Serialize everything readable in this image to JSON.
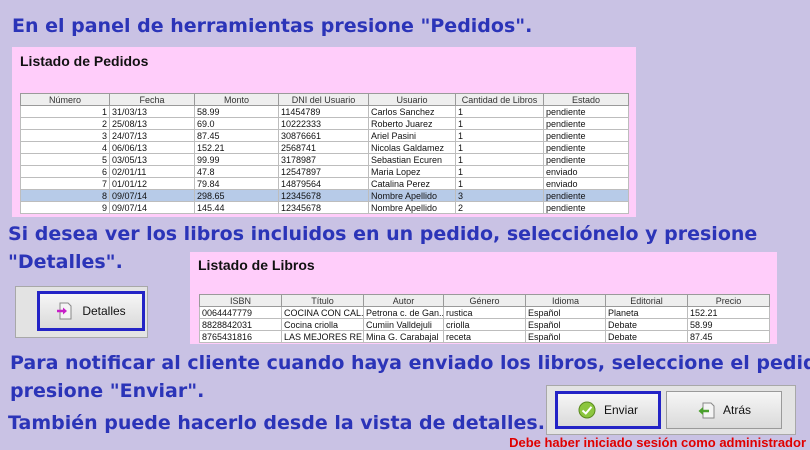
{
  "instructions": {
    "step1": "En el panel de herramientas presione \"Pedidos\".",
    "step2_line1": "Si desea ver los libros incluidos en un pedido, selecciónelo y presione",
    "step2_line2": "\"Detalles\".",
    "step3_line1": "Para notificar al cliente cuando haya enviado los libros, seleccione el pedido y",
    "step3_line2": "presione \"Enviar\".",
    "step4": "También puede hacerlo desde la vista de detalles.",
    "note": "Debe haber iniciado sesión como administrador"
  },
  "orders_panel": {
    "title": "Listado de Pedidos",
    "columns": [
      "Número",
      "Fecha",
      "Monto",
      "DNI del Usuario",
      "Usuario",
      "Cantidad de Libros",
      "Estado"
    ],
    "rows": [
      [
        "1",
        "31/03/13",
        "58.99",
        "11454789",
        "Carlos Sanchez",
        "1",
        "pendiente"
      ],
      [
        "2",
        "25/08/13",
        "69.0",
        "10222333",
        "Roberto Juarez",
        "1",
        "pendiente"
      ],
      [
        "3",
        "24/07/13",
        "87.45",
        "30876661",
        "Ariel Pasini",
        "1",
        "pendiente"
      ],
      [
        "4",
        "06/06/13",
        "152.21",
        "2568741",
        "Nicolas Galdamez",
        "1",
        "pendiente"
      ],
      [
        "5",
        "03/05/13",
        "99.99",
        "3178987",
        "Sebastian Ecuren",
        "1",
        "pendiente"
      ],
      [
        "6",
        "02/01/11",
        "47.8",
        "12547897",
        "Maria Lopez",
        "1",
        "enviado"
      ],
      [
        "7",
        "01/01/12",
        "79.84",
        "14879564",
        "Catalina Perez",
        "1",
        "enviado"
      ],
      [
        "8",
        "09/07/14",
        "298.65",
        "12345678",
        "Nombre Apellido",
        "3",
        "pendiente"
      ],
      [
        "9",
        "09/07/14",
        "145.44",
        "12345678",
        "Nombre Apellido",
        "2",
        "pendiente"
      ]
    ],
    "selected_row": 7
  },
  "books_panel": {
    "title": "Listado de Libros",
    "columns": [
      "ISBN",
      "Título",
      "Autor",
      "Género",
      "Idioma",
      "Editorial",
      "Precio"
    ],
    "rows": [
      [
        "0064447779",
        "COCINA CON CAL...",
        "Petrona c. de Gan...",
        "rustica",
        "Español",
        "Planeta",
        "152.21"
      ],
      [
        "8828842031",
        "Cocina criolla",
        "Cumiin Valldejuli",
        "criolla",
        "Español",
        "Debate",
        "58.99"
      ],
      [
        "8765431816",
        "LAS MEJORES RE...",
        "Mina G. Carabajal",
        "receta",
        "Español",
        "Debate",
        "87.45"
      ]
    ]
  },
  "buttons": {
    "detalles": "Detalles",
    "enviar": "Enviar",
    "atras": "Atrás"
  },
  "colors": {
    "background": "#c9c2e4",
    "instruction_text": "#2b34b8",
    "panel": "#ffcdfa",
    "selected_row": "#b7cbe8",
    "highlight_border": "#2323c6",
    "note_text": "#e00000"
  }
}
